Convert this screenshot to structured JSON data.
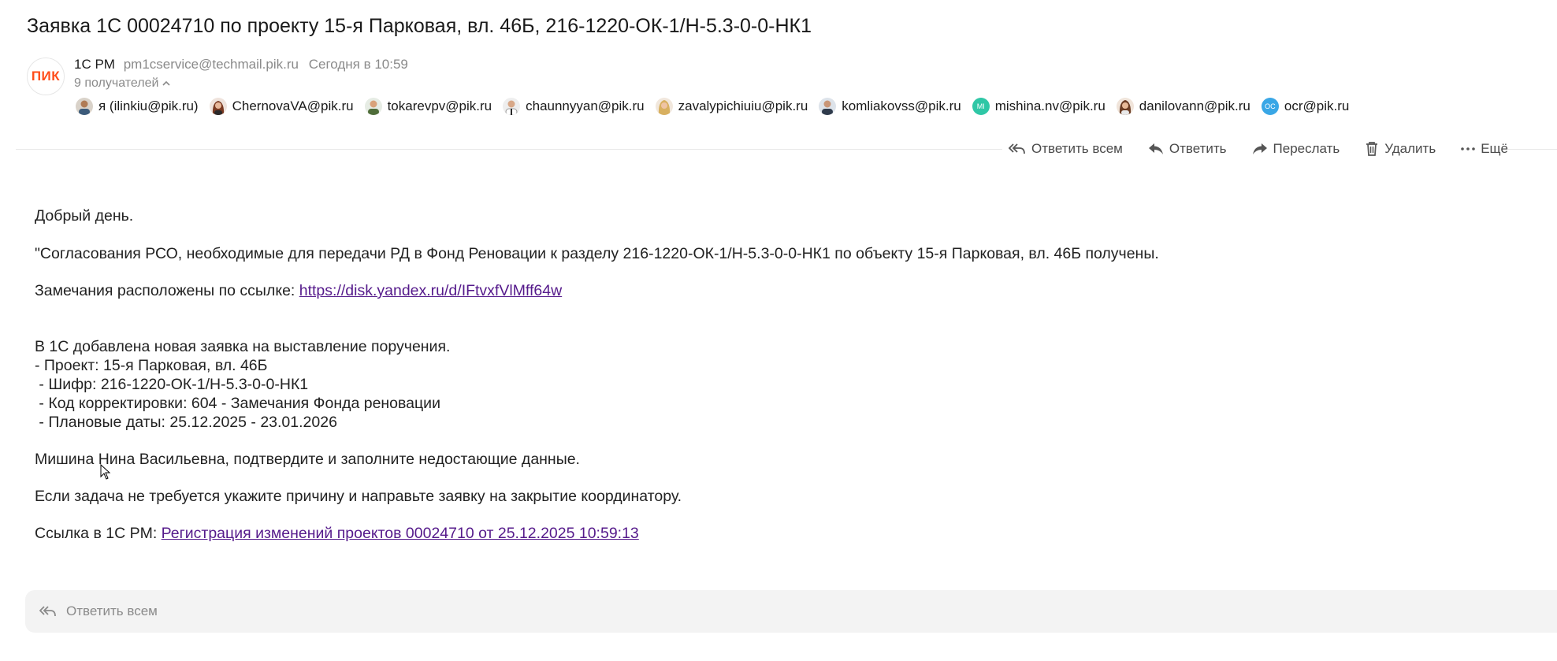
{
  "subject": "Заявка 1С 00024710 по проекту 15-я Парковая, вл. 46Б, 216-1220-ОК-1/Н-5.3-0-0-НК1",
  "sender": {
    "logo": "ПИК",
    "name": "1C PM",
    "email": "pm1cservice@techmail.pik.ru",
    "date": "Сегодня в 10:59"
  },
  "recipients_count": "9 получателей",
  "recipients": [
    {
      "label": "я (ilinkiu@pik.ru)",
      "icon": "user-photo"
    },
    {
      "label": "ChernovaVA@pik.ru",
      "icon": "user-photo"
    },
    {
      "label": "tokarevpv@pik.ru",
      "icon": "user-photo"
    },
    {
      "label": "chaunnyyan@pik.ru",
      "icon": "user-photo"
    },
    {
      "label": "zavalypichiuiu@pik.ru",
      "icon": "user-photo"
    },
    {
      "label": "komliakovss@pik.ru",
      "icon": "user-photo"
    },
    {
      "label": "mishina.nv@pik.ru",
      "initials": "MI",
      "color": "#2fc7a6"
    },
    {
      "label": "danilovann@pik.ru",
      "icon": "user-photo"
    },
    {
      "label": "ocr@pik.ru",
      "initials": "OC",
      "color": "#3aa7e6"
    }
  ],
  "toolbar": {
    "reply_all": "Ответить всем",
    "reply": "Ответить",
    "forward": "Переслать",
    "delete": "Удалить",
    "more": "Ещё"
  },
  "body": {
    "greeting": "Добрый день.",
    "line1": "\"Согласования РСО, необходимые для передачи РД в Фонд Реновации к разделу 216-1220-ОК-1/Н-5.3-0-0-НК1 по объекту 15-я Парковая, вл. 46Б получены.",
    "remarks_prefix": "Замечания расположены по ссылке: ",
    "remarks_link": "https://disk.yandex.ru/d/IFtvxfVlMff64w",
    "added": "В 1С добавлена новая заявка на выставление поручения.",
    "project": "- Проект: 15-я Парковая, вл. 46Б",
    "cipher": " - Шифр: 216-1220-ОК-1/Н-5.3-0-0-НК1",
    "code": " - Код корректировки: 604 - Замечания Фонда реновации",
    "dates": " - Плановые даты: 25.12.2025 - 23.01.2026",
    "confirm": "Мишина Нина Васильевна, подтвердите и заполните недостающие данные.",
    "if_not_needed": "Если задача не требуется укажите причину и направьте заявку на закрытие координатору.",
    "link_prefix": "Ссылка в 1С PM: ",
    "link_text": "Регистрация изменений проектов 00024710 от 25.12.2025 10:59:13"
  },
  "reply_placeholder": "Ответить всем"
}
